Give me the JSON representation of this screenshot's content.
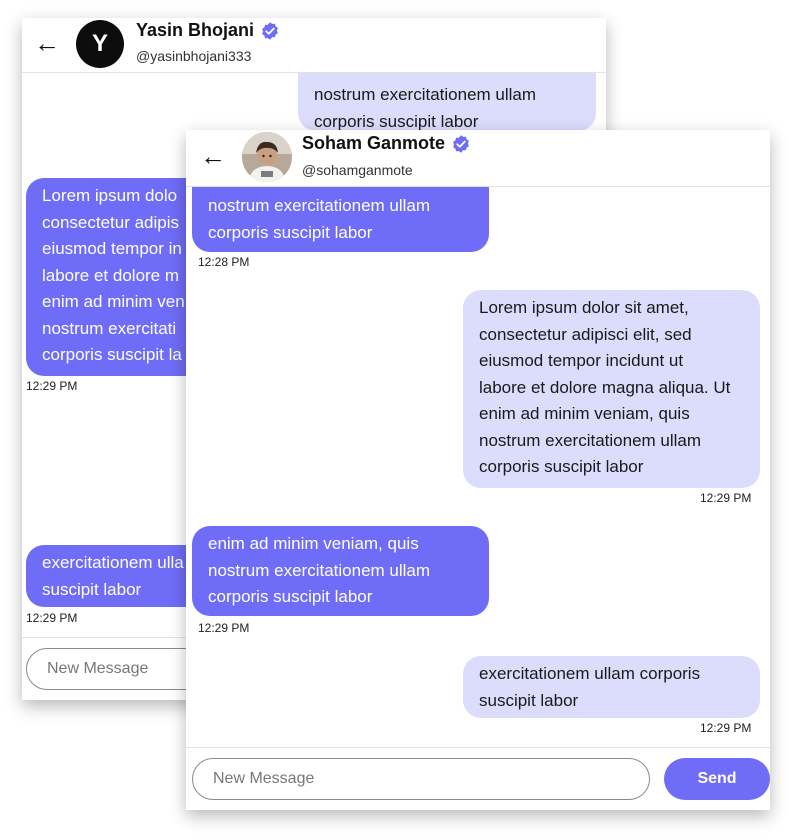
{
  "colors": {
    "accent": "#6f6cf7",
    "sent_bubble": "#dcdcfc",
    "verified_badge": "#6f6cf7"
  },
  "back_chat": {
    "header": {
      "back_icon": "arrow-left-icon",
      "avatar_letter": "Y",
      "name": "Yasin Bhojani",
      "handle": "@yasinbhojani333",
      "verified_icon": "verified-badge-icon"
    },
    "messages": [
      {
        "direction": "sent",
        "text": "nostrum exercitationem ullam\ncorporis suscipit labor"
      },
      {
        "direction": "received",
        "text": "Lorem ipsum dolo\nconsectetur adipis\neiusmod tempor in\nlabore et dolore m\nenim ad minim ven\nnostrum exercitati\ncorporis suscipit la",
        "time": "12:29 PM"
      },
      {
        "direction": "received",
        "text": "exercitationem ulla\nsuscipit labor",
        "time": "12:29 PM"
      }
    ],
    "composer": {
      "placeholder": "New Message"
    }
  },
  "front_chat": {
    "header": {
      "back_icon": "arrow-left-icon",
      "name": "Soham Ganmote",
      "handle": "@sohamganmote",
      "verified_icon": "verified-badge-icon"
    },
    "messages": [
      {
        "direction": "received",
        "text": "nostrum exercitationem ullam\ncorporis suscipit labor",
        "time": "12:28 PM"
      },
      {
        "direction": "sent",
        "text": "Lorem ipsum dolor sit amet,\nconsectetur adipisci elit, sed\neiusmod tempor incidunt ut\nlabore et dolore magna aliqua. Ut\nenim ad minim veniam, quis\nnostrum exercitationem ullam\ncorporis suscipit labor",
        "time": "12:29 PM"
      },
      {
        "direction": "received",
        "text": "enim ad minim veniam, quis\nnostrum exercitationem ullam\ncorporis suscipit labor",
        "time": "12:29 PM"
      },
      {
        "direction": "sent",
        "text": "exercitationem ullam corporis\nsuscipit labor",
        "time": "12:29 PM"
      }
    ],
    "composer": {
      "placeholder": "New Message",
      "send_label": "Send"
    }
  }
}
